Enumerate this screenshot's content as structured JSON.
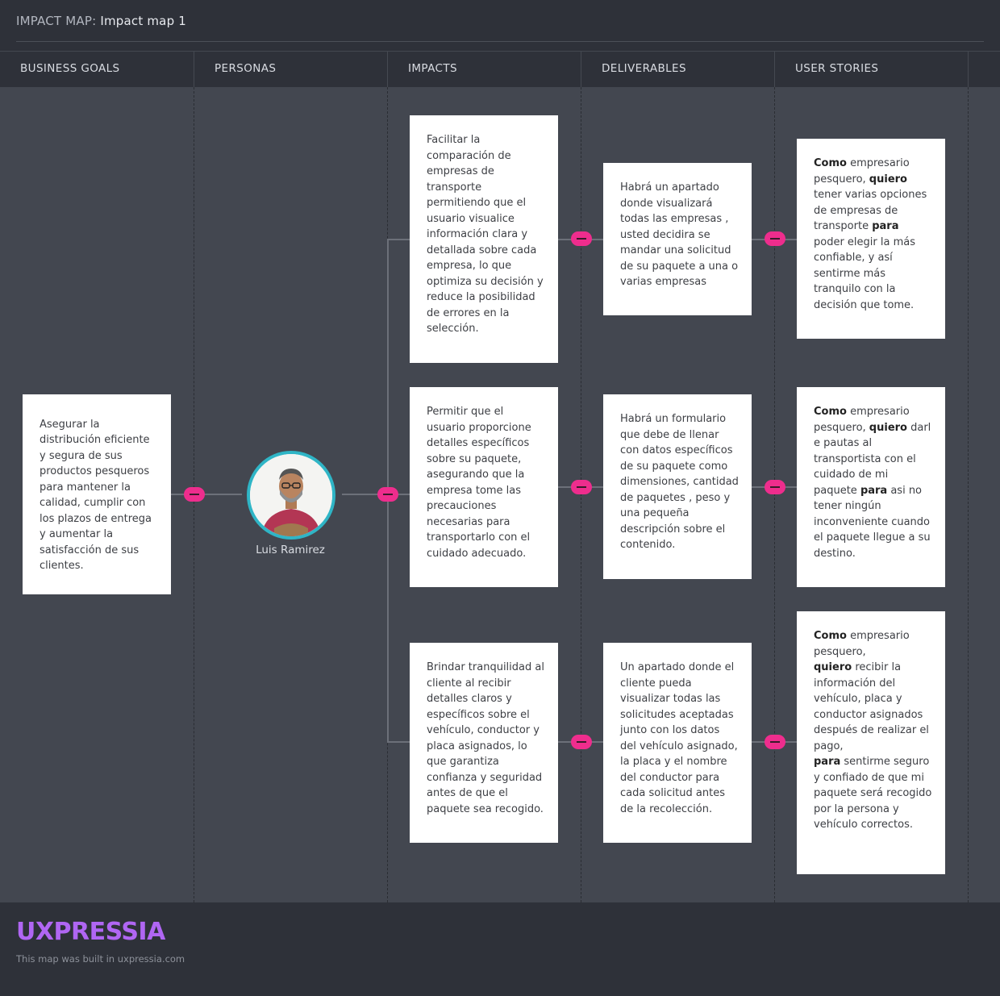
{
  "header": {
    "prefix": "IMPACT MAP:",
    "map_name": "Impact map 1"
  },
  "columns": [
    "BUSINESS GOALS",
    "PERSONAS",
    "IMPACTS",
    "DELIVERABLES",
    "USER STORIES"
  ],
  "business_goal": "Asegurar la distribución eficiente y segura de sus productos pesqueros para mantener la calidad, cumplir con los plazos de entrega y aumentar la satisfacción de sus clientes.",
  "persona": {
    "name": "Luis Ramirez",
    "avatar_icon": "person-photo"
  },
  "impacts": [
    "Facilitar la comparación de empresas de transporte permitiendo que el usuario visualice información clara y detallada sobre cada empresa, lo que optimiza su decisión y reduce la posibilidad de errores en la selección.",
    "Permitir que el usuario proporcione detalles específicos sobre su paquete, asegurando que la empresa tome las precauciones necesarias para transportarlo con el cuidado adecuado.",
    "Brindar tranquilidad al cliente al recibir detalles claros y específicos sobre el vehículo, conductor y placa asignados, lo que garantiza confianza y seguridad antes de que el paquete sea recogido."
  ],
  "deliverables": [
    "Habrá un apartado donde visualizará todas las empresas , usted decidira se mandar una solicitud de su paquete a una o varias empresas",
    "Habrá un formulario que debe de llenar con datos específicos de su paquete como dimensiones, cantidad de paquetes , peso y una pequeña descripción sobre el contenido.",
    "Un apartado donde el cliente pueda visualizar todas las solicitudes aceptadas junto con los datos del vehículo asignado, la placa y el nombre del conductor para cada solicitud antes de la recolección."
  ],
  "user_stories": [
    {
      "k_como": "Como",
      "t1": " empresario pesquero, ",
      "k_quiero": "quiero",
      "t2": " tener varias opciones de empresas de transporte ",
      "k_para": "para",
      "t3": " poder elegir la más confiable, y así sentirme más tranquilo con la decisión que tome."
    },
    {
      "k_como": "Como",
      "t1": " empresario pesquero, ",
      "k_quiero": "quiero",
      "t2": " darl e pautas al transportista con el cuidado de mi paquete ",
      "k_para": "para",
      "t3": " asi no tener ningún inconveniente cuando el paquete llegue a su destino."
    },
    {
      "k_como": "Como",
      "t1": " empresario pesquero,",
      "k_quiero": "quiero",
      "t2": " recibir la información del vehículo, placa y conductor asignados después de realizar el pago,",
      "k_para": "para",
      "t3": " sentirme seguro y confiado de que mi paquete será recogido por la persona y vehículo correctos."
    }
  ],
  "footer": {
    "logo": "UXPRESSIA",
    "built_text": "This map was built in uxpressia.com"
  },
  "colors": {
    "accent_toggle": "#ee2d8d",
    "persona_ring": "#2fb5c6",
    "logo": "#b066f3",
    "canvas": "#434750",
    "chrome": "#2e3139"
  }
}
